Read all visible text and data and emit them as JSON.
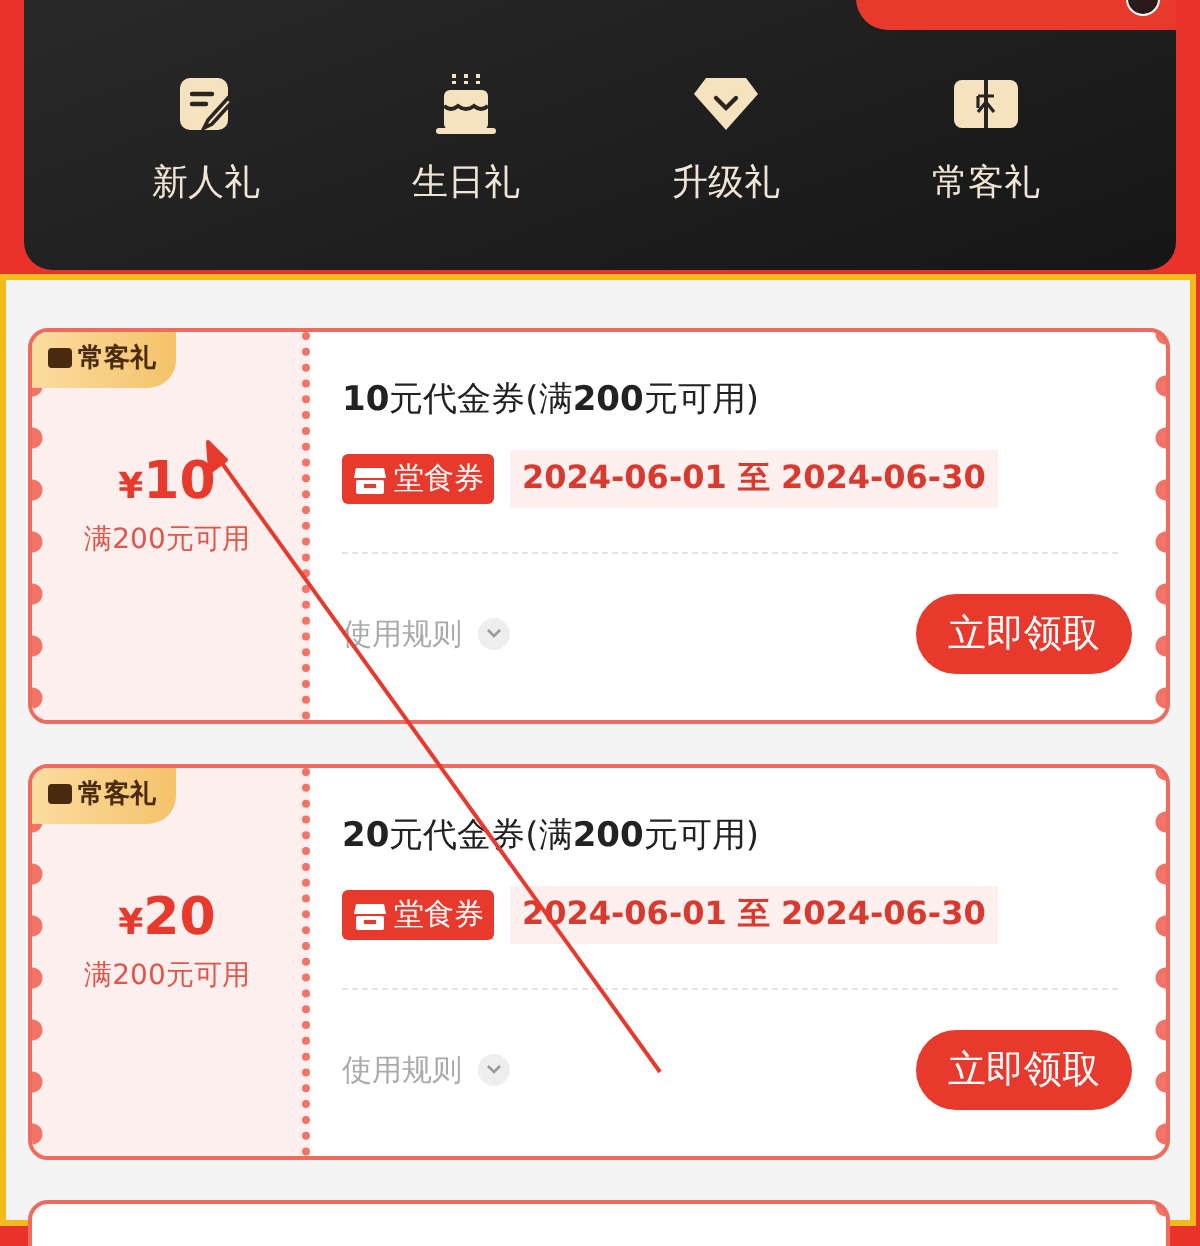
{
  "categories": [
    {
      "label": "新人礼"
    },
    {
      "label": "生日礼"
    },
    {
      "label": "升级礼"
    },
    {
      "label": "常客礼"
    }
  ],
  "coupons": [
    {
      "tag": "常客礼",
      "price": "¥10",
      "condition": "满200元可用",
      "title": "**10**元代金券(满**200**元可用)",
      "type_badge": "堂食券",
      "validity": "2024-06-01 至 2024-06-30",
      "rules": "使用规则",
      "claim_button": "立即领取"
    },
    {
      "tag": "常客礼",
      "price": "¥20",
      "condition": "满200元可用",
      "title": "**20**元代金券(满**200**元可用)",
      "type_badge": "堂食券",
      "validity": "2024-06-01 至 2024-06-30",
      "rules": "使用规则",
      "claim_button": "立即领取"
    }
  ]
}
